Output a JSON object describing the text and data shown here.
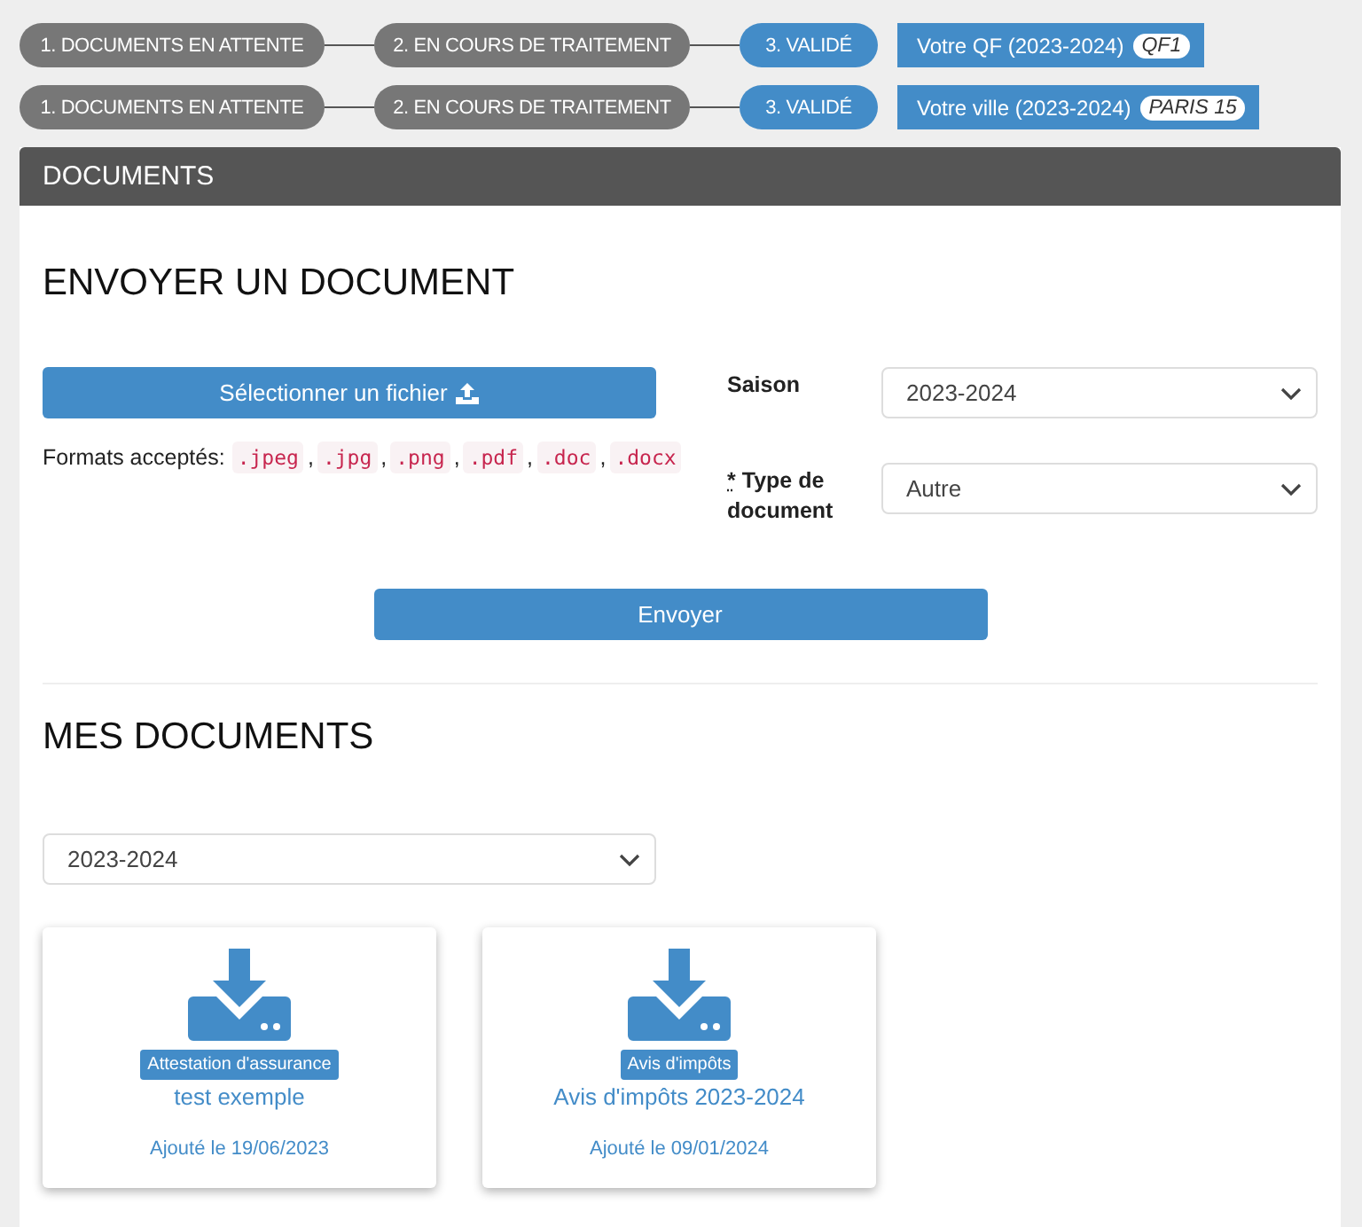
{
  "status_rows": [
    {
      "steps": [
        {
          "label": "1. DOCUMENTS EN ATTENTE",
          "selected": false
        },
        {
          "label": "2. EN COURS DE TRAITEMENT",
          "selected": false
        },
        {
          "label": "3. VALIDÉ",
          "selected": true
        }
      ],
      "info": {
        "label": "Votre QF (2023-2024)",
        "badge": "QF1"
      }
    },
    {
      "steps": [
        {
          "label": "1. DOCUMENTS EN ATTENTE",
          "selected": false
        },
        {
          "label": "2. EN COURS DE TRAITEMENT",
          "selected": false
        },
        {
          "label": "3. VALIDÉ",
          "selected": true
        }
      ],
      "info": {
        "label": "Votre ville (2023-2024)",
        "badge": "PARIS 15"
      }
    }
  ],
  "panel": {
    "title": "DOCUMENTS"
  },
  "upload": {
    "heading": "ENVOYER UN DOCUMENT",
    "file_button": "Sélectionner un fichier",
    "formats_label": "Formats acceptés:",
    "separator": ",",
    "formats": [
      ".jpeg",
      ".jpg",
      ".png",
      ".pdf",
      ".doc",
      ".docx"
    ],
    "season": {
      "label": "Saison",
      "value": "2023-2024"
    },
    "doc_type": {
      "required_mark": "*",
      "label": "Type de document",
      "value": "Autre"
    },
    "submit": "Envoyer"
  },
  "my_documents": {
    "heading": "MES DOCUMENTS",
    "season_filter": "2023-2024",
    "cards": [
      {
        "tag": "Attestation d'assurance",
        "title": "test exemple",
        "date": "Ajouté le 19/06/2023"
      },
      {
        "tag": "Avis d'impôts",
        "title": "Avis d'impôts 2023-2024",
        "date": "Ajouté le 09/01/2024"
      }
    ]
  }
}
